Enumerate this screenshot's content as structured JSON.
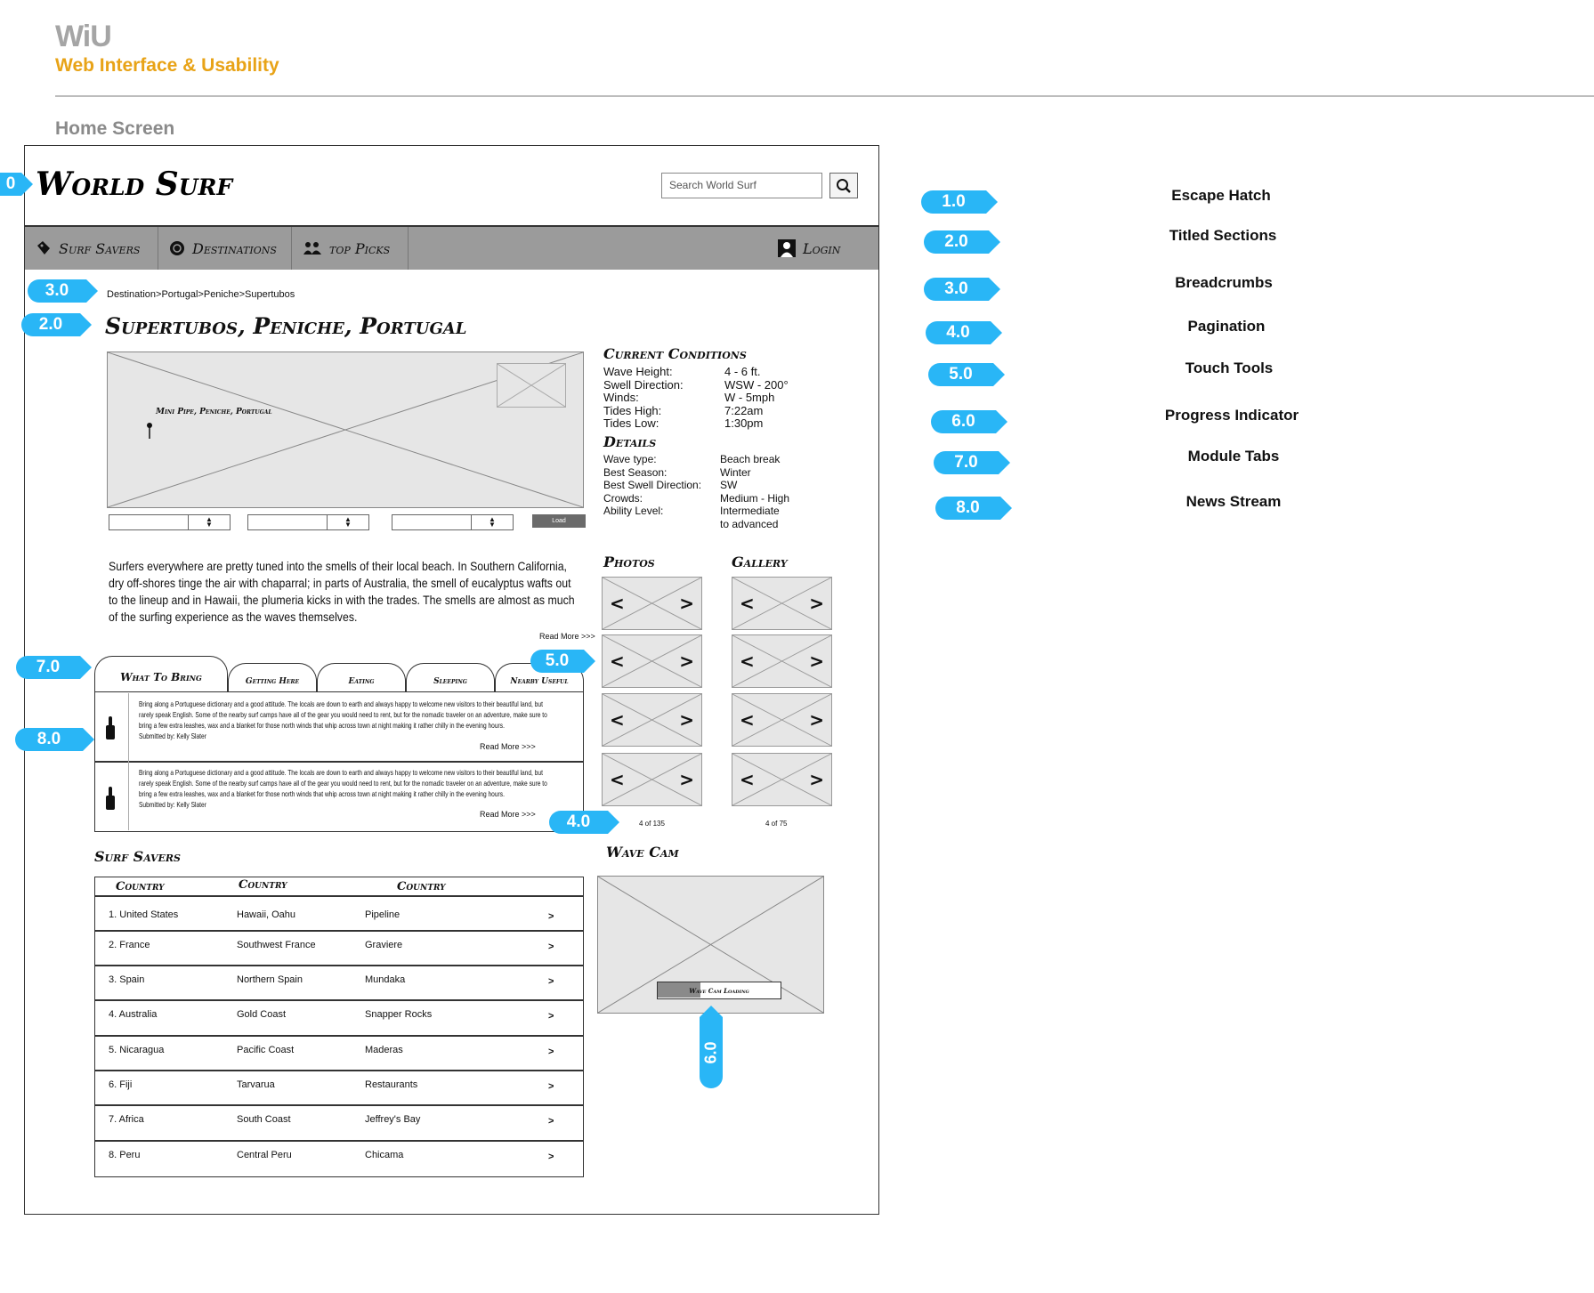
{
  "page": {
    "brand": "WiU",
    "brand_subtitle": "Web Interface & Usability",
    "screen_title": "Home Screen"
  },
  "site": {
    "logo": "World Surf",
    "search_placeholder": "Search World Surf",
    "nav": [
      "Surf Savers",
      "Destinations",
      "top Picks"
    ],
    "login": "Login",
    "breadcrumb": "Destination>Portugal>Peniche>Supertubos",
    "page_heading": "Supertubos, Peniche, Portugal",
    "map_label": "Mini Pipe, Peniche, Portugal",
    "load_label": "Load"
  },
  "conditions": {
    "title": "Current Conditions",
    "rows": [
      {
        "label": "Wave Height:",
        "value": "4 - 6 ft."
      },
      {
        "label": "Swell Direction:",
        "value": "WSW - 200°"
      },
      {
        "label": "Winds:",
        "value": "W - 5mph"
      },
      {
        "label": "Tides High:",
        "value": "7:22am"
      },
      {
        "label": "Tides Low:",
        "value": "1:30pm"
      }
    ]
  },
  "details": {
    "title": "Details",
    "rows": [
      {
        "label": "Wave type:",
        "value": "Beach break"
      },
      {
        "label": "Best Season:",
        "value": "Winter"
      },
      {
        "label": "Best Swell Direction:",
        "value": "SW"
      },
      {
        "label": "Crowds:",
        "value": "Medium - High"
      },
      {
        "label": "Ability Level:",
        "value": "Intermediate"
      },
      {
        "label": "",
        "value": "to advanced"
      }
    ]
  },
  "intro": {
    "text": "Surfers everywhere are pretty tuned into the smells of their local beach. In Southern California, dry off-shores tinge the air with chaparral; in parts of Australia, the smell of eucalyptus wafts out to the lineup and in Hawaii, the plumeria kicks in with the trades. The smells are almost as much of the surfing experience as the waves themselves.",
    "read_more": "Read More >>>"
  },
  "tabs": [
    "What To Bring",
    "Getting Here",
    "Eating",
    "Sleeping",
    "Nearby Useful"
  ],
  "news": [
    {
      "text": "Bring along a Portuguese dictionary and a good attitude. The locals are down to earth and always happy to welcome new visitors to their beautiful land, but rarely speak English. Some of the nearby surf camps have all of the gear you would need to rent, but for the nomadic traveler on an adventure, make sure to bring a few extra leashes, wax and a blanket for those north winds that whip across town at night making it rather chilly in the evening hours.",
      "submitted": "Submitted by: Kelly Slater",
      "read_more": "Read More >>>"
    },
    {
      "text": "Bring along a Portuguese dictionary and a good attitude. The locals are down to earth and always happy to welcome new visitors to their beautiful land, but rarely speak English. Some of the nearby surf camps have all of the gear you would need to rent, but for the nomadic traveler on an adventure, make sure to bring a few extra leashes, wax and a blanket for those north winds that whip across town at night making it rather chilly in the evening hours.",
      "submitted": "Submitted by: Kelly Slater",
      "read_more": "Read More >>>"
    }
  ],
  "photos": {
    "title": "Photos",
    "count": "4 of 135",
    "prev": "<",
    "next": ">"
  },
  "gallery": {
    "title": "Gallery",
    "count": "4 of 75",
    "prev": "<",
    "next": ">"
  },
  "surf_savers": {
    "title": "Surf Savers",
    "headers": [
      "Country",
      "Country",
      "Country"
    ],
    "rows": [
      [
        "1. United States",
        "Hawaii, Oahu",
        "Pipeline",
        ">"
      ],
      [
        "2. France",
        "Southwest France",
        "Graviere",
        ">"
      ],
      [
        "3. Spain",
        "Northern Spain",
        "Mundaka",
        ">"
      ],
      [
        "4. Australia",
        "Gold Coast",
        "Snapper Rocks",
        ">"
      ],
      [
        "5. Nicaragua",
        "Pacific Coast",
        "Maderas",
        ">"
      ],
      [
        "6. Fiji",
        "Tarvarua",
        "Restaurants",
        ">"
      ],
      [
        "7. Africa",
        "South Coast",
        "Jeffrey's Bay",
        ">"
      ],
      [
        "8. Peru",
        "Central Peru",
        "Chicama",
        ">"
      ]
    ]
  },
  "wave_cam": {
    "title": "Wave Cam",
    "loading": "Wave Cam Loading",
    "progress": 0.35
  },
  "callouts": {
    "escape_hatch": "0",
    "breadcrumbs": "3.0",
    "titled_sections": "2.0",
    "touch_tools": "5.0",
    "module_tabs": "7.0",
    "news_stream": "8.0",
    "pagination": "4.0",
    "progress": "6.0"
  },
  "legend": [
    {
      "num": "1.0",
      "label": "Escape Hatch"
    },
    {
      "num": "2.0",
      "label": "Titled Sections"
    },
    {
      "num": "3.0",
      "label": "Breadcrumbs"
    },
    {
      "num": "4.0",
      "label": "Pagination"
    },
    {
      "num": "5.0",
      "label": "Touch Tools"
    },
    {
      "num": "6.0",
      "label": "Progress Indicator"
    },
    {
      "num": "7.0",
      "label": "Module Tabs"
    },
    {
      "num": "8.0",
      "label": "News Stream"
    }
  ],
  "colors": {
    "callout": "#29b6f6",
    "brand_subtitle": "#e8a317",
    "nav": "#9b9b9b"
  }
}
